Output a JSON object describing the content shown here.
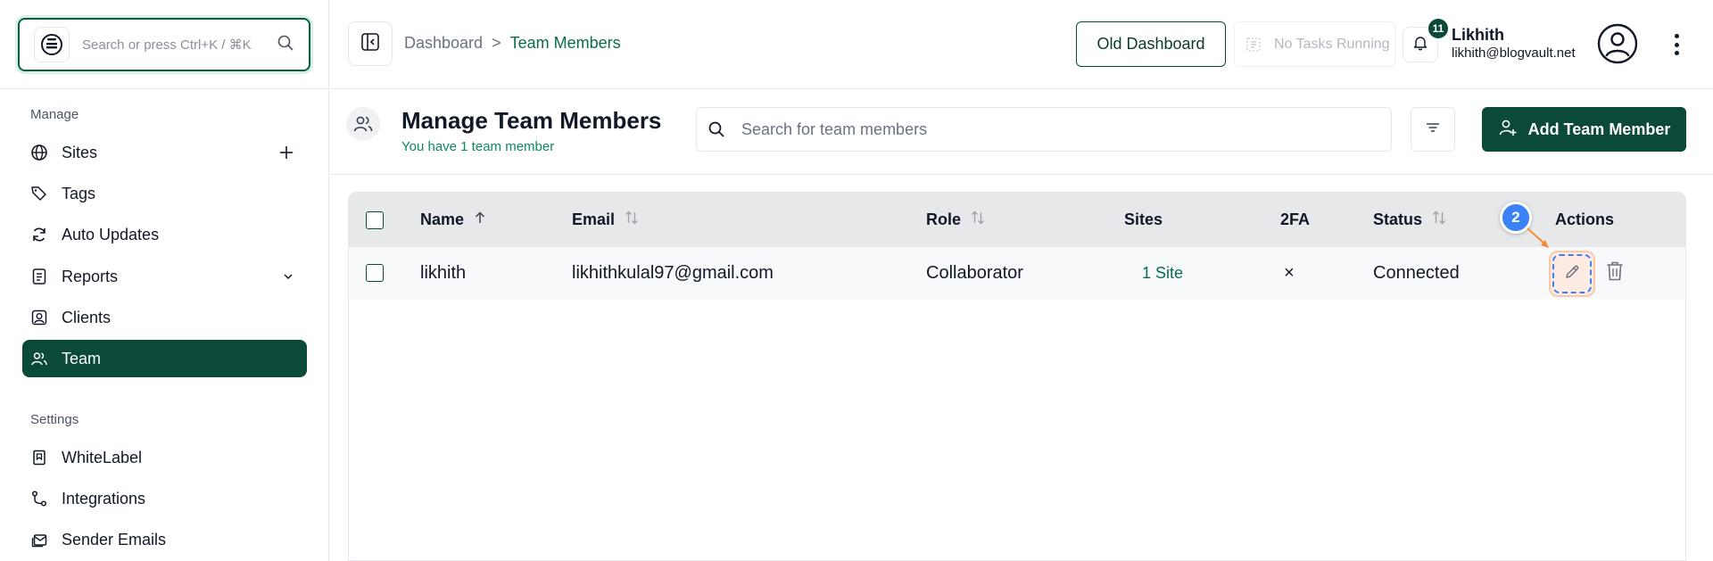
{
  "sidebar": {
    "search_placeholder": "Search or press Ctrl+K / ⌘K",
    "manage_label": "Manage",
    "settings_label": "Settings",
    "items": [
      {
        "label": "Sites",
        "icon": "globe-icon"
      },
      {
        "label": "Tags",
        "icon": "tags-icon"
      },
      {
        "label": "Auto Updates",
        "icon": "refresh-icon"
      },
      {
        "label": "Reports",
        "icon": "report-icon"
      },
      {
        "label": "Clients",
        "icon": "clients-icon"
      },
      {
        "label": "Team",
        "icon": "team-icon",
        "active": true
      },
      {
        "label": "WhiteLabel",
        "icon": "bookmark-icon"
      },
      {
        "label": "Integrations",
        "icon": "integrations-icon"
      },
      {
        "label": "Sender Emails",
        "icon": "mail-stack-icon"
      }
    ]
  },
  "header": {
    "breadcrumb_home": "Dashboard",
    "breadcrumb_sep": ">",
    "breadcrumb_current": "Team Members",
    "old_dashboard": "Old Dashboard",
    "tasks_status": "No Tasks Running",
    "notification_count": "11",
    "user_name": "Likhith",
    "user_email": "likhith@blogvault.net"
  },
  "page": {
    "title": "Manage Team Members",
    "subtitle": "You have 1 team member",
    "search_placeholder": "Search for team members",
    "add_button": "Add Team Member"
  },
  "table": {
    "columns": {
      "name": "Name",
      "email": "Email",
      "role": "Role",
      "sites": "Sites",
      "twofa": "2FA",
      "status": "Status",
      "actions": "Actions"
    },
    "rows": [
      {
        "name": "likhith",
        "email": "likhithkulal97@gmail.com",
        "role": "Collaborator",
        "sites": "1 Site",
        "twofa": "×",
        "status": "Connected"
      }
    ]
  },
  "annotation": {
    "step": "2"
  },
  "colors": {
    "brand": "#0b4a38",
    "accent_link": "#0b6b50",
    "annotation_blue": "#3b82f6",
    "highlight": "#fdebe1"
  }
}
